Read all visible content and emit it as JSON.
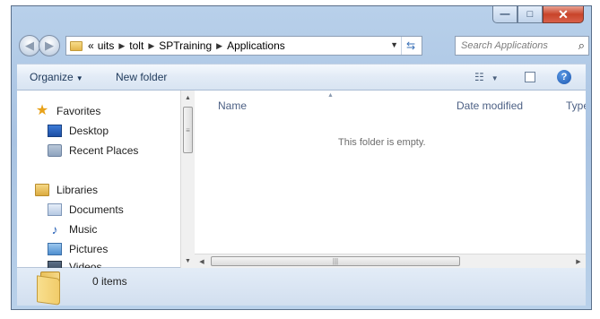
{
  "window": {
    "controls": {
      "minimize": "—",
      "maximize": "□",
      "close": "✕"
    }
  },
  "nav": {
    "back_icon": "back-arrow",
    "forward_icon": "forward-arrow",
    "address": {
      "overflow": "«",
      "crumbs": [
        "uits",
        "tolt",
        "SPTraining",
        "Applications"
      ]
    },
    "search_placeholder": "Search Applications"
  },
  "toolbar": {
    "organize_label": "Organize",
    "new_folder_label": "New folder",
    "help_glyph": "?"
  },
  "sidebar": {
    "items": [
      {
        "label": "Favorites",
        "icon": "star-icon"
      },
      {
        "label": "Desktop",
        "icon": "desktop-icon"
      },
      {
        "label": "Recent Places",
        "icon": "recent-places-icon"
      },
      {
        "label": "Libraries",
        "icon": "libraries-icon"
      },
      {
        "label": "Documents",
        "icon": "documents-icon"
      },
      {
        "label": "Music",
        "icon": "music-icon"
      },
      {
        "label": "Pictures",
        "icon": "pictures-icon"
      },
      {
        "label": "Videos",
        "icon": "videos-icon"
      }
    ]
  },
  "main": {
    "columns": [
      "Name",
      "Date modified",
      "Type"
    ],
    "empty_message": "This folder is empty."
  },
  "details": {
    "items_count": "0 items"
  },
  "colors": {
    "frame": "#b8d0ea",
    "accent": "#1e395b",
    "close": "#c8442a"
  }
}
